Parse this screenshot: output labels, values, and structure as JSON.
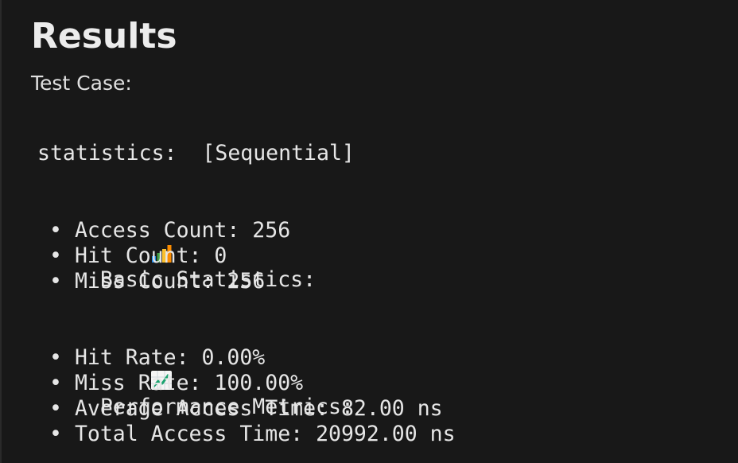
{
  "results": {
    "title": "Results",
    "test_case_label": "Test Case:"
  },
  "statistics": {
    "line": "statistics:  [Sequential]"
  },
  "basic": {
    "icon": "bar-chart-icon",
    "heading": "Basic Statistics:",
    "items": [
      "Access Count: 256",
      "Hit Count: 0",
      "Miss Count: 256"
    ]
  },
  "performance": {
    "icon": "trending-up-chart-icon",
    "heading": "Performance Metrics:",
    "items": [
      "Hit Rate: 0.00%",
      "Miss Rate: 100.00%",
      "Average Access Time: 82.00 ns",
      "Total Access Time: 20992.00 ns"
    ]
  },
  "bullet_char": "•",
  "colors": {
    "background": "#181818",
    "text": "#e6e6e6"
  }
}
